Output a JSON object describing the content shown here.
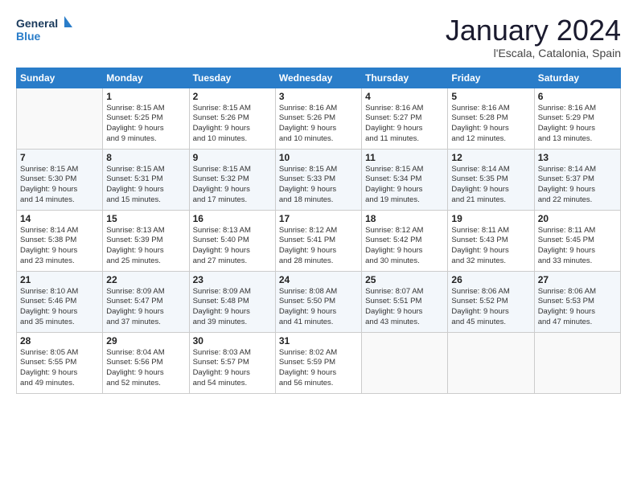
{
  "logo": {
    "line1": "General",
    "line2": "Blue"
  },
  "title": "January 2024",
  "subtitle": "l'Escala, Catalonia, Spain",
  "headers": [
    "Sunday",
    "Monday",
    "Tuesday",
    "Wednesday",
    "Thursday",
    "Friday",
    "Saturday"
  ],
  "weeks": [
    [
      {
        "num": "",
        "info": ""
      },
      {
        "num": "1",
        "info": "Sunrise: 8:15 AM\nSunset: 5:25 PM\nDaylight: 9 hours\nand 9 minutes."
      },
      {
        "num": "2",
        "info": "Sunrise: 8:15 AM\nSunset: 5:26 PM\nDaylight: 9 hours\nand 10 minutes."
      },
      {
        "num": "3",
        "info": "Sunrise: 8:16 AM\nSunset: 5:26 PM\nDaylight: 9 hours\nand 10 minutes."
      },
      {
        "num": "4",
        "info": "Sunrise: 8:16 AM\nSunset: 5:27 PM\nDaylight: 9 hours\nand 11 minutes."
      },
      {
        "num": "5",
        "info": "Sunrise: 8:16 AM\nSunset: 5:28 PM\nDaylight: 9 hours\nand 12 minutes."
      },
      {
        "num": "6",
        "info": "Sunrise: 8:16 AM\nSunset: 5:29 PM\nDaylight: 9 hours\nand 13 minutes."
      }
    ],
    [
      {
        "num": "7",
        "info": "Sunrise: 8:15 AM\nSunset: 5:30 PM\nDaylight: 9 hours\nand 14 minutes."
      },
      {
        "num": "8",
        "info": "Sunrise: 8:15 AM\nSunset: 5:31 PM\nDaylight: 9 hours\nand 15 minutes."
      },
      {
        "num": "9",
        "info": "Sunrise: 8:15 AM\nSunset: 5:32 PM\nDaylight: 9 hours\nand 17 minutes."
      },
      {
        "num": "10",
        "info": "Sunrise: 8:15 AM\nSunset: 5:33 PM\nDaylight: 9 hours\nand 18 minutes."
      },
      {
        "num": "11",
        "info": "Sunrise: 8:15 AM\nSunset: 5:34 PM\nDaylight: 9 hours\nand 19 minutes."
      },
      {
        "num": "12",
        "info": "Sunrise: 8:14 AM\nSunset: 5:35 PM\nDaylight: 9 hours\nand 21 minutes."
      },
      {
        "num": "13",
        "info": "Sunrise: 8:14 AM\nSunset: 5:37 PM\nDaylight: 9 hours\nand 22 minutes."
      }
    ],
    [
      {
        "num": "14",
        "info": "Sunrise: 8:14 AM\nSunset: 5:38 PM\nDaylight: 9 hours\nand 23 minutes."
      },
      {
        "num": "15",
        "info": "Sunrise: 8:13 AM\nSunset: 5:39 PM\nDaylight: 9 hours\nand 25 minutes."
      },
      {
        "num": "16",
        "info": "Sunrise: 8:13 AM\nSunset: 5:40 PM\nDaylight: 9 hours\nand 27 minutes."
      },
      {
        "num": "17",
        "info": "Sunrise: 8:12 AM\nSunset: 5:41 PM\nDaylight: 9 hours\nand 28 minutes."
      },
      {
        "num": "18",
        "info": "Sunrise: 8:12 AM\nSunset: 5:42 PM\nDaylight: 9 hours\nand 30 minutes."
      },
      {
        "num": "19",
        "info": "Sunrise: 8:11 AM\nSunset: 5:43 PM\nDaylight: 9 hours\nand 32 minutes."
      },
      {
        "num": "20",
        "info": "Sunrise: 8:11 AM\nSunset: 5:45 PM\nDaylight: 9 hours\nand 33 minutes."
      }
    ],
    [
      {
        "num": "21",
        "info": "Sunrise: 8:10 AM\nSunset: 5:46 PM\nDaylight: 9 hours\nand 35 minutes."
      },
      {
        "num": "22",
        "info": "Sunrise: 8:09 AM\nSunset: 5:47 PM\nDaylight: 9 hours\nand 37 minutes."
      },
      {
        "num": "23",
        "info": "Sunrise: 8:09 AM\nSunset: 5:48 PM\nDaylight: 9 hours\nand 39 minutes."
      },
      {
        "num": "24",
        "info": "Sunrise: 8:08 AM\nSunset: 5:50 PM\nDaylight: 9 hours\nand 41 minutes."
      },
      {
        "num": "25",
        "info": "Sunrise: 8:07 AM\nSunset: 5:51 PM\nDaylight: 9 hours\nand 43 minutes."
      },
      {
        "num": "26",
        "info": "Sunrise: 8:06 AM\nSunset: 5:52 PM\nDaylight: 9 hours\nand 45 minutes."
      },
      {
        "num": "27",
        "info": "Sunrise: 8:06 AM\nSunset: 5:53 PM\nDaylight: 9 hours\nand 47 minutes."
      }
    ],
    [
      {
        "num": "28",
        "info": "Sunrise: 8:05 AM\nSunset: 5:55 PM\nDaylight: 9 hours\nand 49 minutes."
      },
      {
        "num": "29",
        "info": "Sunrise: 8:04 AM\nSunset: 5:56 PM\nDaylight: 9 hours\nand 52 minutes."
      },
      {
        "num": "30",
        "info": "Sunrise: 8:03 AM\nSunset: 5:57 PM\nDaylight: 9 hours\nand 54 minutes."
      },
      {
        "num": "31",
        "info": "Sunrise: 8:02 AM\nSunset: 5:59 PM\nDaylight: 9 hours\nand 56 minutes."
      },
      {
        "num": "",
        "info": ""
      },
      {
        "num": "",
        "info": ""
      },
      {
        "num": "",
        "info": ""
      }
    ]
  ]
}
